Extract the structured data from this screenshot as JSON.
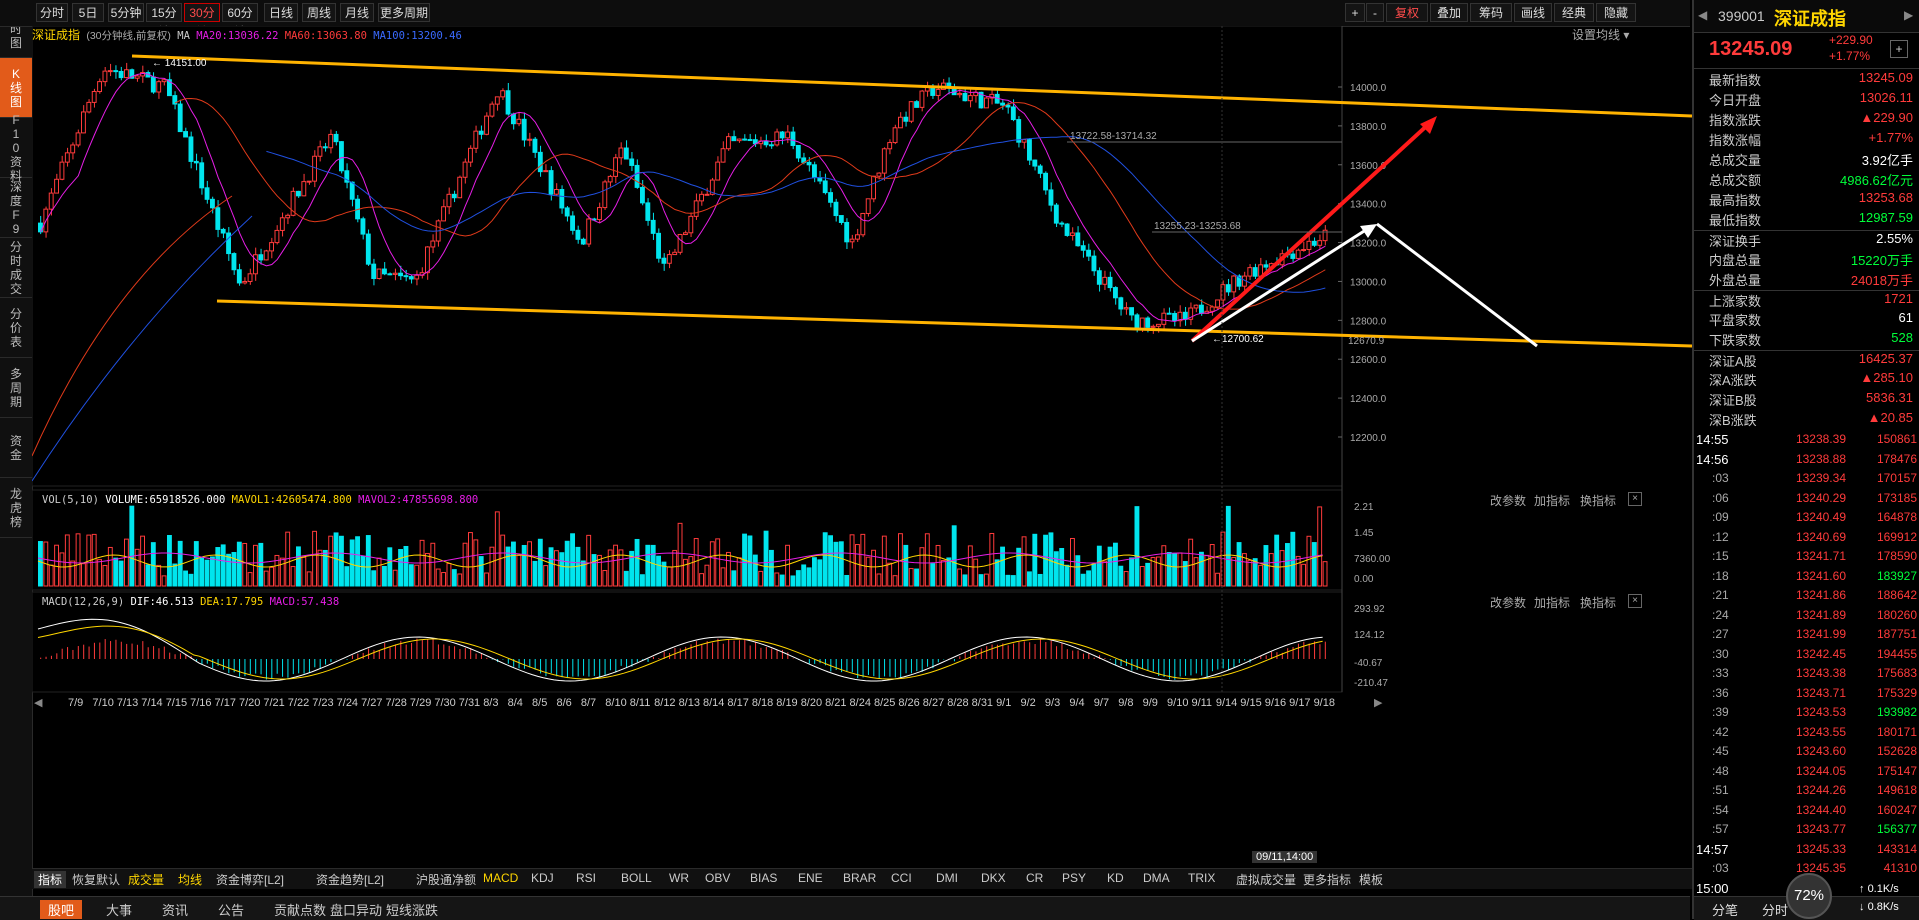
{
  "sidebar": [
    "分时图",
    "K线图",
    "F10资料",
    "深度F9",
    "分时成交",
    "分价表",
    "多周期",
    "资金",
    "龙虎榜"
  ],
  "toolbar": {
    "periods": [
      "分时",
      "5日",
      "5分钟",
      "15分钟",
      "30分钟",
      "60分钟",
      "日线",
      "周线",
      "月线",
      "更多周期"
    ],
    "active_period": "30分钟",
    "right_buttons": [
      "+",
      "-",
      "复权",
      "叠加",
      "筹码",
      "画线",
      "经典",
      "隐藏"
    ]
  },
  "chart_header": {
    "name": "深证成指",
    "desc": "(30分钟线,前复权)",
    "ma_label": "MA",
    "ma20": "MA20:13036.22",
    "ma60": "MA60:13063.80",
    "ma100": "MA100:13200.46",
    "settings": "设置均线"
  },
  "price_annotations": {
    "high": "14151.00",
    "low": "12700.62",
    "range1": "13722.58-13714.32",
    "range2": "13255.23-13253.68",
    "last_mark": "12670.9"
  },
  "y_axis_price": [
    "14000.0",
    "13800.0",
    "13600.0",
    "13400.0",
    "13200.0",
    "13000.0",
    "12800.0",
    "12600.0",
    "12400.0",
    "12200.0"
  ],
  "vol_header": {
    "label": "VOL(5,10)",
    "volume": "VOLUME:65918526.000",
    "mavol1": "MAVOL1:42605474.800",
    "mavol2": "MAVOL2:47855698.800"
  },
  "y_axis_vol": [
    "2.21",
    "1.45",
    "7360.00",
    "0.00"
  ],
  "macd_header": {
    "label": "MACD(12,26,9)",
    "dif": "DIF:46.513",
    "dea": "DEA:17.795",
    "macd": "MACD:57.438"
  },
  "y_axis_macd": [
    "293.92",
    "124.12",
    "-40.67",
    "-210.47"
  ],
  "pane_buttons": [
    "改参数",
    "加指标",
    "换指标"
  ],
  "x_axis": [
    "7/9",
    "7/10",
    "7/13",
    "7/14",
    "7/15",
    "7/16",
    "7/17",
    "7/20",
    "7/21",
    "7/22",
    "7/23",
    "7/24",
    "7/27",
    "7/28",
    "7/29",
    "7/30",
    "7/31",
    "8/3",
    "8/4",
    "8/5",
    "8/6",
    "8/7",
    "8/10",
    "8/11",
    "8/12",
    "8/13",
    "8/14",
    "8/17",
    "8/18",
    "8/19",
    "8/20",
    "8/21",
    "8/24",
    "8/25",
    "8/26",
    "8/27",
    "8/28",
    "8/31",
    "9/1",
    "9/2",
    "9/3",
    "9/4",
    "9/7",
    "9/8",
    "9/9",
    "9/10",
    "9/11",
    "9/14",
    "9/15",
    "9/16",
    "9/17",
    "9/18"
  ],
  "cursor_time": "09/11,14:00",
  "indicator_tabs": [
    "指标",
    "恢复默认",
    "成交量",
    "均线",
    "资金博弈[L2]",
    "资金趋势[L2]",
    "沪股通净额",
    "MACD",
    "KDJ",
    "RSI",
    "BOLL",
    "WR",
    "OBV",
    "BIAS",
    "ENE",
    "BRAR",
    "CCI",
    "DMI",
    "DKX",
    "CR",
    "PSY",
    "KD",
    "DMA",
    "TRIX",
    "虚拟成交量",
    "更多指标",
    "模板"
  ],
  "bottom_tabs": [
    "股吧",
    "大事",
    "资讯",
    "公告",
    "贡献点数",
    "盘口异动",
    "短线涨跌"
  ],
  "quote": {
    "code": "399001",
    "name": "深证成指",
    "price": "13245.09",
    "change": "+229.90",
    "change_pct": "+1.77%",
    "rows": [
      {
        "label": "最新指数",
        "value": "13245.09",
        "color": "red"
      },
      {
        "label": "今日开盘",
        "value": "13026.11",
        "color": "red"
      },
      {
        "label": "指数涨跌",
        "value": "▲229.90",
        "color": "red"
      },
      {
        "label": "指数涨幅",
        "value": "+1.77%",
        "color": "red"
      },
      {
        "label": "总成交量",
        "value": "3.92亿手",
        "color": "white"
      },
      {
        "label": "总成交额",
        "value": "4986.62亿元",
        "color": "green"
      },
      {
        "label": "最高指数",
        "value": "13253.68",
        "color": "red"
      },
      {
        "label": "最低指数",
        "value": "12987.59",
        "color": "green"
      },
      {
        "label": "深证换手",
        "value": "2.55%",
        "color": "white"
      },
      {
        "label": "内盘总量",
        "value": "15220万手",
        "color": "green"
      },
      {
        "label": "外盘总量",
        "value": "24018万手",
        "color": "red"
      },
      {
        "label": "上涨家数",
        "value": "1721",
        "color": "red"
      },
      {
        "label": "平盘家数",
        "value": "61",
        "color": "white"
      },
      {
        "label": "下跌家数",
        "value": "528",
        "color": "green"
      },
      {
        "label": "深证A股",
        "value": "16425.37",
        "color": "red"
      },
      {
        "label": "深A涨跌",
        "value": "▲285.10",
        "color": "red"
      },
      {
        "label": "深证B股",
        "value": "5836.31",
        "color": "red"
      },
      {
        "label": "深B涨跌",
        "value": "▲20.85",
        "color": "red"
      }
    ],
    "ticks": [
      {
        "t": "14:55",
        "p": "13238.39",
        "v": "150861",
        "vc": "red",
        "bold": true
      },
      {
        "t": "14:56",
        "p": "13238.88",
        "v": "178476",
        "vc": "red",
        "bold": true
      },
      {
        "t": ":03",
        "p": "13239.34",
        "v": "170157",
        "vc": "red"
      },
      {
        "t": ":06",
        "p": "13240.29",
        "v": "173185",
        "vc": "red"
      },
      {
        "t": ":09",
        "p": "13240.49",
        "v": "164878",
        "vc": "red"
      },
      {
        "t": ":12",
        "p": "13240.69",
        "v": "169912",
        "vc": "red"
      },
      {
        "t": ":15",
        "p": "13241.71",
        "v": "178590",
        "vc": "red"
      },
      {
        "t": ":18",
        "p": "13241.60",
        "v": "183927",
        "vc": "green"
      },
      {
        "t": ":21",
        "p": "13241.86",
        "v": "188642",
        "vc": "red"
      },
      {
        "t": ":24",
        "p": "13241.89",
        "v": "180260",
        "vc": "red"
      },
      {
        "t": ":27",
        "p": "13241.99",
        "v": "187751",
        "vc": "red"
      },
      {
        "t": ":30",
        "p": "13242.45",
        "v": "194455",
        "vc": "red"
      },
      {
        "t": ":33",
        "p": "13243.38",
        "v": "175683",
        "vc": "red"
      },
      {
        "t": ":36",
        "p": "13243.71",
        "v": "175329",
        "vc": "red"
      },
      {
        "t": ":39",
        "p": "13243.53",
        "v": "193982",
        "vc": "green"
      },
      {
        "t": ":42",
        "p": "13243.55",
        "v": "180171",
        "vc": "red"
      },
      {
        "t": ":45",
        "p": "13243.60",
        "v": "152628",
        "vc": "red"
      },
      {
        "t": ":48",
        "p": "13244.05",
        "v": "175147",
        "vc": "red"
      },
      {
        "t": ":51",
        "p": "13244.26",
        "v": "149618",
        "vc": "red"
      },
      {
        "t": ":54",
        "p": "13244.40",
        "v": "160247",
        "vc": "red"
      },
      {
        "t": ":57",
        "p": "13243.77",
        "v": "156377",
        "vc": "green"
      },
      {
        "t": "14:57",
        "p": "13245.33",
        "v": "143314",
        "vc": "red",
        "bold": true
      },
      {
        "t": ":03",
        "p": "13245.35",
        "v": "41310",
        "vc": "red"
      },
      {
        "t": "15:00",
        "p": "",
        "v": "",
        "vc": "red",
        "bold": true
      }
    ],
    "footer_tabs": [
      "分笔",
      "分时"
    ],
    "net_pct": "72%",
    "net_up": "0.1K/s",
    "net_down": "0.8K/s"
  },
  "colors": {
    "up": "#ff3b3b",
    "down": "#00e5ee",
    "ma20": "#e61ee6",
    "ma60": "#e03a1a",
    "ma100": "#2050e0",
    "trend": "#ffb300"
  }
}
